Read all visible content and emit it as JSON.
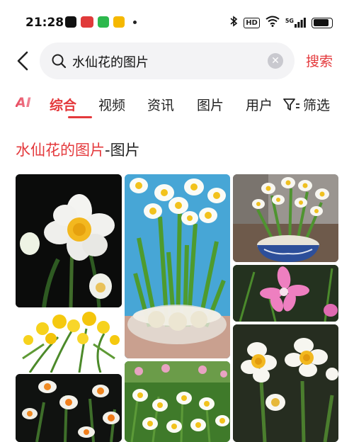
{
  "status_bar": {
    "time": "21:28",
    "hd": "HD",
    "network": "5G"
  },
  "search": {
    "query": "水仙花的图片",
    "submit_label": "搜索"
  },
  "tabs": [
    {
      "label": "AI"
    },
    {
      "label": "综合"
    },
    {
      "label": "视频"
    },
    {
      "label": "资讯"
    },
    {
      "label": "图片"
    },
    {
      "label": "用户"
    }
  ],
  "filter_label": "筛选",
  "section": {
    "title_highlight": "水仙花的图片",
    "title_suffix": "-图片"
  },
  "colors": {
    "accent": "#e4393c"
  }
}
